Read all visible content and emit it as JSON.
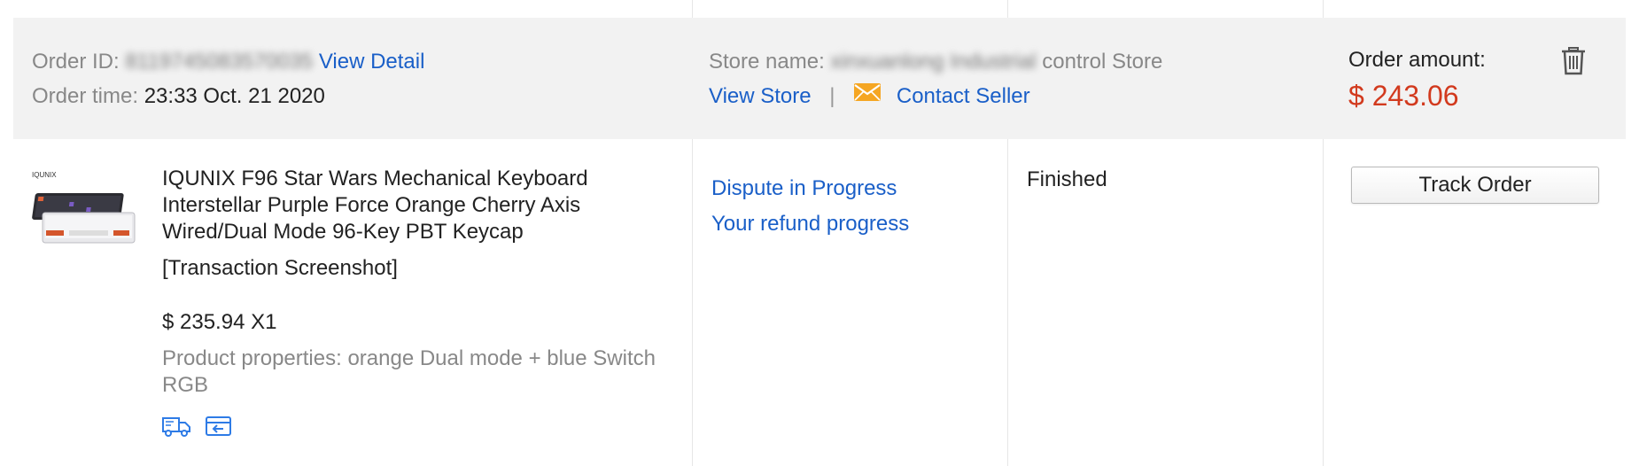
{
  "order": {
    "id_label": "Order ID:",
    "id_value": "8119745083570035",
    "view_detail": "View Detail",
    "time_label": "Order time:",
    "time_value": "23:33 Oct. 21 2020"
  },
  "store": {
    "name_label": "Store name:",
    "name_value_blurred": "xinxuanlong Industrial",
    "name_suffix": "control Store",
    "view_store": "View Store",
    "separator": "|",
    "contact_seller": "Contact Seller"
  },
  "amount": {
    "label": "Order amount:",
    "value": "$ 243.06"
  },
  "product": {
    "title_line1": "IQUNIX F96 Star Wars Mechanical Keyboard",
    "title_line2": "Interstellar Purple Force Orange Cherry Axis",
    "title_line3": "Wired/Dual Mode 96-Key PBT Keycap",
    "transaction_screenshot": "[Transaction Screenshot]",
    "price_qty": "$ 235.94 X1",
    "properties_line1": "Product properties: orange Dual mode + blue Switch",
    "properties_line2": "RGB",
    "image_brand": "IQUNIX"
  },
  "dispute": {
    "status_link": "Dispute in Progress",
    "refund_link": "Your refund progress"
  },
  "status": {
    "text": "Finished"
  },
  "actions": {
    "track_order": "Track Order"
  },
  "colors": {
    "link": "#1a5fc8",
    "amount": "#d23a1e",
    "header_bg": "#f2f2f2",
    "envelope": "#f5a623"
  }
}
